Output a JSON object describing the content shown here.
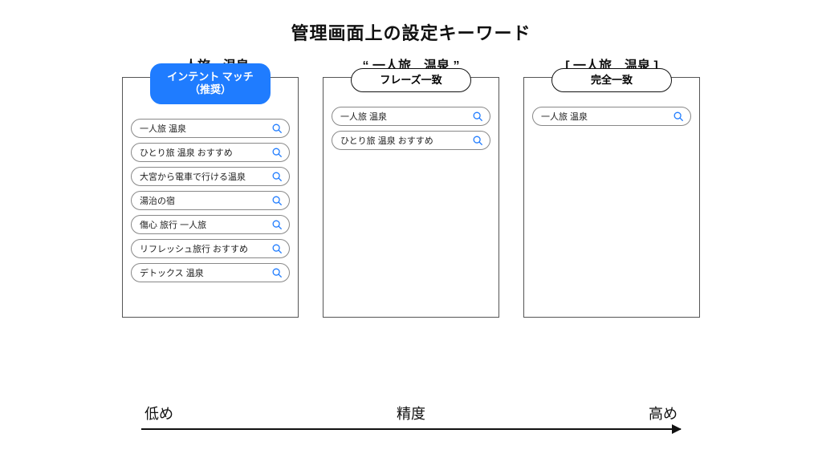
{
  "title": "管理画面上の設定キーワード",
  "columns": [
    {
      "keyword": "一人旅　温泉",
      "label": "インテント マッチ\n（推奨）",
      "highlight": true,
      "searches": [
        "一人旅 温泉",
        "ひとり旅 温泉 おすすめ",
        "大宮から電車で行ける温泉",
        "湯治の宿",
        "傷心 旅行 一人旅",
        "リフレッシュ旅行 おすすめ",
        "デトックス 温泉"
      ]
    },
    {
      "keyword": "“ 一人旅　温泉 ”",
      "label": "フレーズ一致",
      "highlight": false,
      "searches": [
        "一人旅 温泉",
        "ひとり旅 温泉 おすすめ"
      ]
    },
    {
      "keyword": "[ 一人旅　温泉 ]",
      "label": "完全一致",
      "highlight": false,
      "searches": [
        "一人旅 温泉"
      ]
    }
  ],
  "axis": {
    "left": "低め",
    "center": "精度",
    "right": "高め"
  }
}
